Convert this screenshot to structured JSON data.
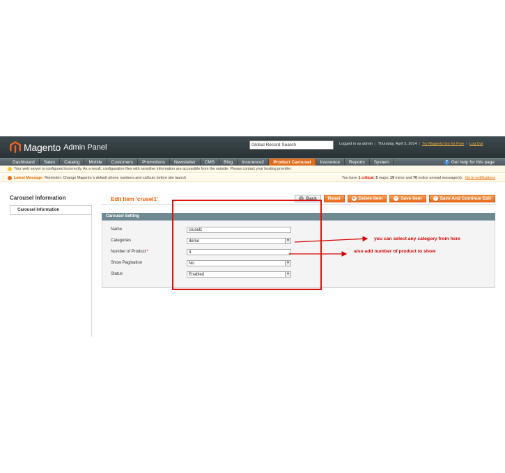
{
  "header": {
    "brand": "Magento",
    "brand_sub": "Admin Panel",
    "search_value": "Global Record Search",
    "logged_in": "Logged in as admin",
    "date": "Thursday, April 3, 2014",
    "try_link": "Try Magento Go for Free",
    "logout": "Log Out"
  },
  "nav": {
    "items": [
      "Dashboard",
      "Sales",
      "Catalog",
      "Mobile",
      "Customers",
      "Promotions",
      "Newsletter",
      "CMS",
      "Blog",
      "Insurence2",
      "Product Carousel",
      "Insurence",
      "Reports",
      "System"
    ],
    "active": "Product Carousel",
    "help": "Get help for this page"
  },
  "messages": {
    "warning": "Your web server is configured incorrectly. As a result, configuration files with sensitive information are accessible from the outside. Please contact your hosting provider.",
    "latest_label": "Latest Message:",
    "latest_text": "Reminder: Change Magento`s default phone numbers and callouts before site launch",
    "counts_prefix": "You have",
    "critical_count": "1",
    "critical_label": "critical",
    "major_count": "5",
    "major_label": "major",
    "minor_count": "19",
    "minor_label": "minor and",
    "notice_count": "70",
    "notice_label": "notice unread message(s).",
    "notifications_link": "Go to notifications"
  },
  "sidebar": {
    "title": "Carousel Information",
    "tab": "Carousel Information"
  },
  "page": {
    "title": "Edit Item 'crusel1'",
    "buttons": {
      "back": "Back",
      "reset": "Reset",
      "delete": "Delete Item",
      "save": "Save Item",
      "save_continue": "Save And Continue Edit"
    }
  },
  "form": {
    "legend": "Carousel Setting",
    "fields": [
      {
        "label": "Name",
        "value": "crusel1",
        "type": "text"
      },
      {
        "label": "Categories",
        "value": "demo",
        "type": "select"
      },
      {
        "label": "Number of Product",
        "value": "4",
        "type": "text",
        "required": "*"
      },
      {
        "label": "Show Pagination",
        "value": "No",
        "type": "select"
      },
      {
        "label": "Status",
        "value": "Enabled",
        "type": "select"
      }
    ]
  },
  "annotations": {
    "categories_note": "you can select any category from here",
    "number_note": "also add number of product to show",
    "color": "#d90000"
  },
  "colors": {
    "header": "#2f393c",
    "accent": "#e16c1c",
    "fieldset_head": "#6f8992"
  }
}
